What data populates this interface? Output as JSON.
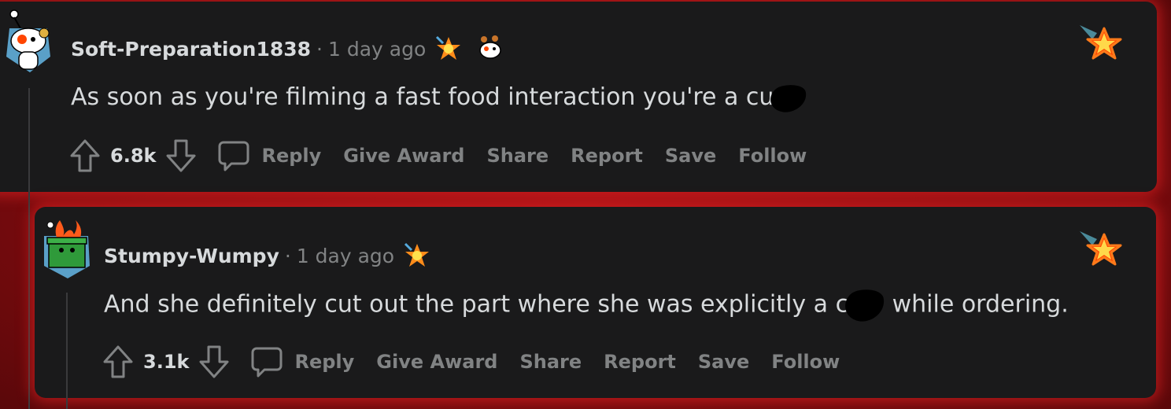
{
  "comments": [
    {
      "username": "Soft-Preparation1838",
      "separator": "·",
      "time": "1 day ago",
      "body_before": "As soon as you're filming a fast food interaction you're a cu",
      "body_after": "",
      "score": "6.8k",
      "actions": {
        "reply": "Reply",
        "give_award": "Give Award",
        "share": "Share",
        "report": "Report",
        "save": "Save",
        "follow": "Follow"
      }
    },
    {
      "username": "Stumpy-Wumpy",
      "separator": "·",
      "time": "1 day ago",
      "body_before": "And she definitely cut out the part where she was explicitly a c",
      "body_after": " while ordering.",
      "score": "3.1k",
      "actions": {
        "reply": "Reply",
        "give_award": "Give Award",
        "share": "Share",
        "report": "Report",
        "save": "Save",
        "follow": "Follow"
      }
    }
  ],
  "colors": {
    "card_bg": "#1a1a1b",
    "glow": "#ff2828",
    "text_primary": "#d7dadc",
    "text_muted": "#818384"
  },
  "icons": [
    "upvote-icon",
    "downvote-icon",
    "reply-icon",
    "award-star-icon",
    "avatar-icon",
    "flair-icon"
  ]
}
